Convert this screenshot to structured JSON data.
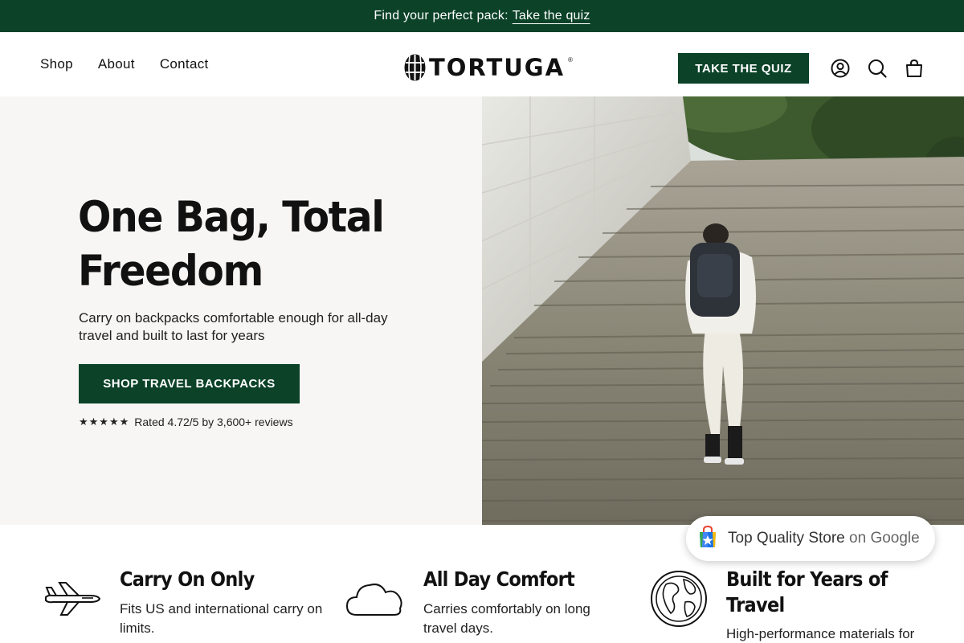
{
  "announcement": {
    "text": "Find your perfect pack:",
    "link": "Take the quiz"
  },
  "nav": {
    "items": [
      "Shop",
      "About",
      "Contact"
    ]
  },
  "logo": {
    "text": "TORTUGA",
    "mark": "®"
  },
  "header": {
    "quiz_button": "TAKE THE QUIZ",
    "icons": [
      "account-icon",
      "search-icon",
      "cart-icon"
    ]
  },
  "hero": {
    "title": "One Bag, Total Freedom",
    "subtitle": "Carry on backpacks comfortable enough for all-day travel and built to last for years",
    "cta": "SHOP TRAVEL BACKPACKS",
    "stars": "★★★★★",
    "rating_text": "Rated 4.72/5 by 3,600+ reviews"
  },
  "features": [
    {
      "icon": "airplane-icon",
      "title": "Carry On Only",
      "text": "Fits US and international carry on limits."
    },
    {
      "icon": "cloud-icon",
      "title": "All Day Comfort",
      "text": "Carries comfortably on long travel days."
    },
    {
      "icon": "globe-icon",
      "title": "Built for Years of Travel",
      "text": "High-performance materials for"
    }
  ],
  "badge": {
    "text": "Top Quality Store",
    "suffix": "on Google",
    "icon": "google-shopping-bag-icon"
  },
  "colors": {
    "brand_green": "#0b4228",
    "hero_bg": "#f7f6f4"
  }
}
